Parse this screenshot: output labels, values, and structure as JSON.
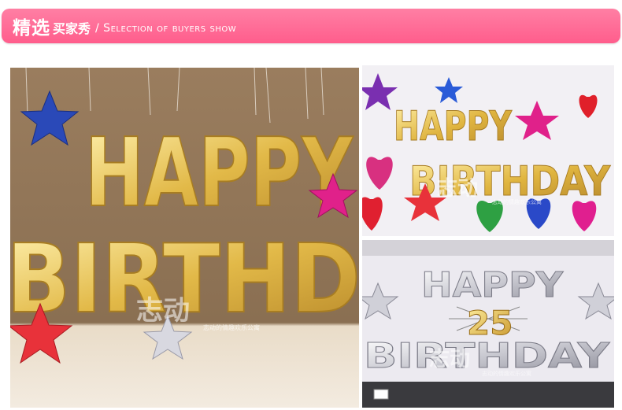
{
  "header": {
    "title_bold": "精选",
    "title_sub": "买家秀",
    "title_en": "/ Selection of buyers show"
  },
  "photos": [
    {
      "name": "buyer-photo-large",
      "line1": "HAPPY",
      "line2": "BIRTHD",
      "watermark": "志动",
      "watermark_sub": "志动的情趣欢乐公寓"
    },
    {
      "name": "buyer-photo-top-right",
      "line1": "HAPPY",
      "line2": "BIRTHDAY",
      "watermark": "志动",
      "watermark_sub": "志动的情趣欢乐公寓"
    },
    {
      "name": "buyer-photo-bottom-right",
      "line1": "HAPPY",
      "number": "25",
      "line2": "BIRTHDAY",
      "watermark": "志动",
      "watermark_sub": "志动的情趣欢乐公寓"
    }
  ],
  "colors": {
    "banner": "#ff6b95",
    "gold_balloon": "#e8c45a",
    "silver_balloon": "#d9d9de",
    "pink_star": "#e0218a",
    "red_star": "#e8323a",
    "blue_star": "#2a49b8"
  }
}
